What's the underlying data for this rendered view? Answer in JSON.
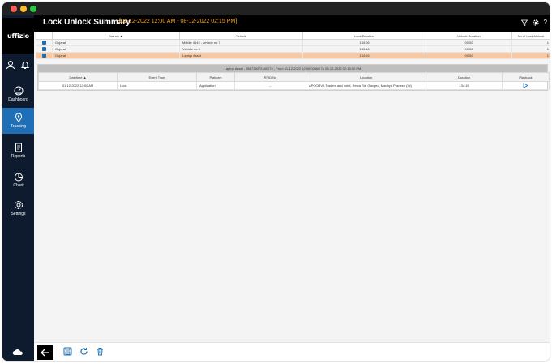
{
  "app": {
    "logo_text": "uffizio",
    "title": "Lock Unlock Summary",
    "date_range": "[01-12-2022 12:00 AM - 08-12-2022 02:15 PM]",
    "help_text": "?"
  },
  "sidebar": {
    "items": [
      {
        "label": "Dashboard",
        "icon": "dashboard-icon"
      },
      {
        "label": "Tracking",
        "icon": "location-pin-icon"
      },
      {
        "label": "Reports",
        "icon": "reports-icon"
      },
      {
        "label": "Chart",
        "icon": "pie-chart-icon"
      },
      {
        "label": "Settings",
        "icon": "gear-icon"
      }
    ],
    "active_index": 1
  },
  "summary": {
    "columns": [
      "",
      "Branch ▲",
      "Vehicle",
      "Lock Duration",
      "Unlock Duration",
      "No of Lock-Unlock"
    ],
    "rows": [
      {
        "branch": "Gujarat",
        "vehicle": "Mobile 4142 - vehicle no 7",
        "lock": "134:06",
        "unlock": "00:00",
        "count": "1",
        "expander": "+"
      },
      {
        "branch": "Gujarat",
        "vehicle": "Vehicle no 5",
        "lock": "133:46",
        "unlock": "00:00",
        "count": "1",
        "expander": "+"
      },
      {
        "branch": "Gujarat",
        "vehicle": "Laptop Asset",
        "lock": "134:15",
        "unlock": "00:00",
        "count": "1",
        "expander": "−"
      }
    ]
  },
  "detail": {
    "title": "Laptop Asset - 358735072349274 - From 01-12-2022 12:00:00 AM To 08-12-2022 02:15:00 PM",
    "columns": [
      "Datetime ▲",
      "Event Type",
      "Platform",
      "RFID No",
      "Location",
      "Duration",
      "Playback"
    ],
    "rows": [
      {
        "datetime": "01-12-2022 12:00 AM",
        "event": "Lock",
        "platform": "Application",
        "rfid": "--",
        "location": "APOORVA Traders and hotel, Rewa Rd, Gangeo, Madhya Pradesh (IN)",
        "duration": "134:15"
      }
    ]
  },
  "colors": {
    "sidebar_bg": "#0e1b2e",
    "active_nav": "#1f6fb6",
    "date_range": "#f5a623",
    "selected_row": "#f7c8a1",
    "play_icon": "#1f6fb6"
  }
}
